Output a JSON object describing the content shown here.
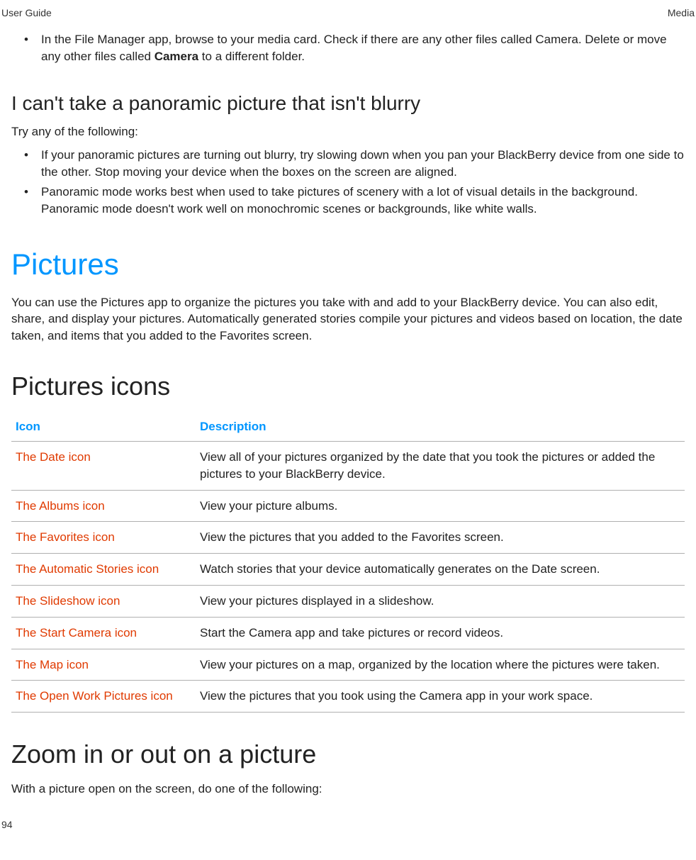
{
  "header": {
    "left": "User Guide",
    "right": "Media"
  },
  "intro_bullet": {
    "pre": "In the File Manager app, browse to your media card. Check if there are any other files called Camera. Delete or move any other files called ",
    "bold": "Camera",
    "post": " to a different folder."
  },
  "panoramic": {
    "heading": "I can't take a panoramic picture that isn't blurry",
    "intro": "Try any of the following:",
    "bullets": [
      "If your panoramic pictures are turning out blurry, try slowing down when you pan your BlackBerry device from one side to the other. Stop moving your device when the boxes on the screen are aligned.",
      "Panoramic mode works best when used to take pictures of scenery with a lot of visual details in the background. Panoramic mode doesn't work well on monochromic scenes or backgrounds, like white walls."
    ]
  },
  "pictures": {
    "heading": "Pictures",
    "intro": "You can use the Pictures app to organize the pictures you take with and add to your BlackBerry device. You can also edit, share, and display your pictures. Automatically generated stories compile your pictures and videos based on location, the date taken, and items that you added to the Favorites screen."
  },
  "icons": {
    "heading": "Pictures icons",
    "col_icon": "Icon",
    "col_desc": "Description",
    "rows": [
      {
        "name": "The Date icon",
        "desc": "View all of your pictures organized by the date that you took the pictures or added the pictures to your BlackBerry device."
      },
      {
        "name": "The Albums icon",
        "desc": "View your picture albums."
      },
      {
        "name": "The Favorites icon",
        "desc": "View the pictures that you added to the Favorites screen."
      },
      {
        "name": "The Automatic Stories icon",
        "desc": "Watch stories that your device automatically generates on the Date screen."
      },
      {
        "name": "The Slideshow icon",
        "desc": "View your pictures displayed in a slideshow."
      },
      {
        "name": "The Start Camera icon",
        "desc": "Start the Camera app and take pictures or record videos."
      },
      {
        "name": "The Map icon",
        "desc": "View your pictures on a map, organized by the location where the pictures were taken."
      },
      {
        "name": "The Open Work Pictures icon",
        "desc": "View the pictures that you took using the Camera app in your work space."
      }
    ]
  },
  "zoom": {
    "heading": "Zoom in or out on a picture",
    "intro": "With a picture open on the screen, do one of the following:"
  },
  "page_number": "94"
}
